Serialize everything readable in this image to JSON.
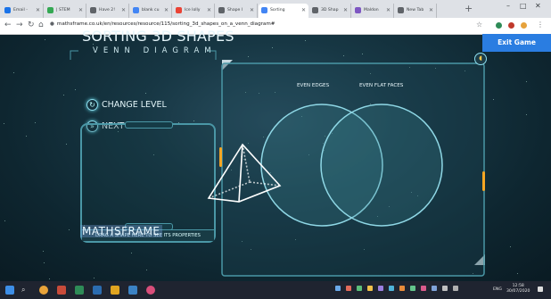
{
  "browser": {
    "tabs": [
      {
        "label": "Email - ",
        "color": "#1a73e8"
      },
      {
        "label": "| STEM",
        "color": "#34a853"
      },
      {
        "label": "Have 2! ",
        "color": "#5f6368"
      },
      {
        "label": "blank cu",
        "color": "#4285f4"
      },
      {
        "label": "Ice lolly",
        "color": "#ea4335"
      },
      {
        "label": "Shape l",
        "color": "#5f6368"
      },
      {
        "label": "Sorting",
        "color": "#4285f4",
        "active": true
      },
      {
        "label": "3D Shap",
        "color": "#5f6368"
      },
      {
        "label": "Maldon",
        "color": "#7e57c2"
      },
      {
        "label": "New Tab",
        "color": "#5f6368"
      }
    ],
    "url": "mathsframe.co.uk/en/resources/resource/115/sorting_3d_shapes_on_a_venn_diagram#"
  },
  "game": {
    "title": "SORTING 3D SHAPES",
    "subtitle": "VENN DIAGRAM",
    "change_level": "CHANGE LEVEL",
    "next": "NEXT",
    "drag_hint": "DRAG A SHAPE HERE TO SEE ITS PROPERTIES",
    "logo": "MATHSFRAME",
    "venn_left_label": "EVEN EDGES",
    "venn_right_label": "EVEN FLAT FACES",
    "exit_label": "Exit Game"
  },
  "taskbar": {
    "time": "12:58",
    "date": "30/07/2020",
    "lang": "ENG"
  },
  "colors": {
    "accent": "#2a7de1",
    "panel_border": "#4a97a6",
    "glow": "#8fe0f0"
  }
}
